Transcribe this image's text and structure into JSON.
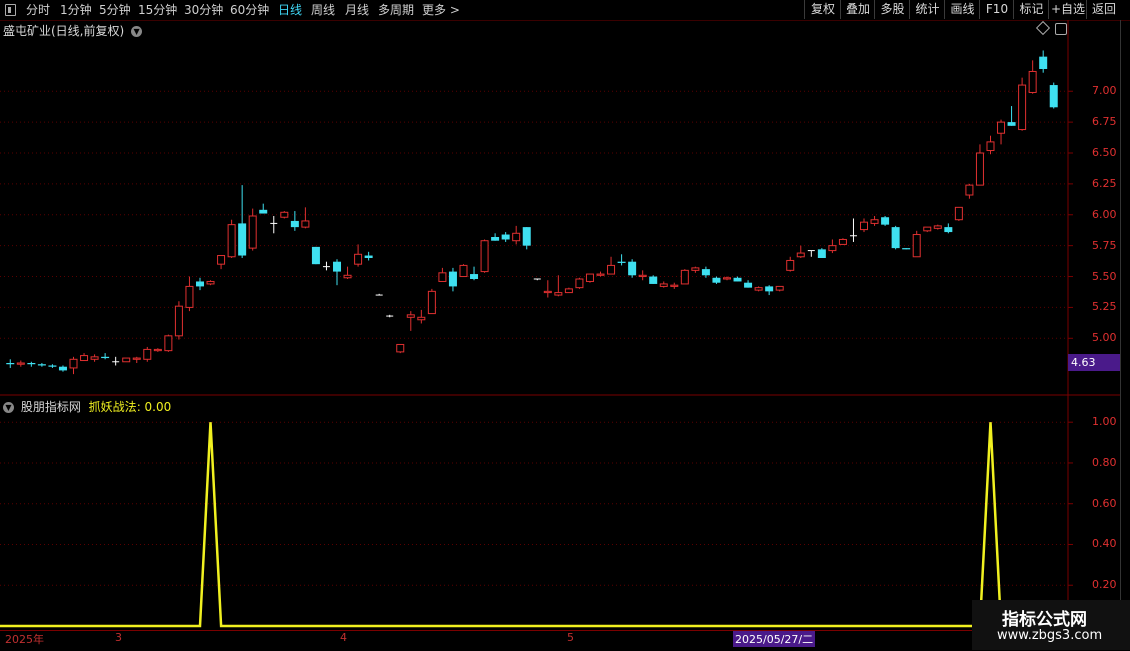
{
  "toolbar": {
    "periods": [
      "分时",
      "1分钟",
      "5分钟",
      "15分钟",
      "30分钟",
      "60分钟",
      "日线",
      "周线",
      "月线",
      "多周期",
      "更多"
    ],
    "active_period": "日线",
    "right_buttons": [
      "复权",
      "叠加",
      "多股",
      "统计",
      "画线",
      "F10",
      "标记",
      "+自选",
      "返回"
    ]
  },
  "main_title": "盛屯矿业(日线,前复权)",
  "current_price_label": "4.63",
  "indicator": {
    "source": "股朋指标网",
    "name": "抓妖战法",
    "value": "0.00",
    "label_sep": ": "
  },
  "date_axis": {
    "labels": [
      "2025年",
      "3",
      "4",
      "5",
      "2025/05/27/二"
    ]
  },
  "watermark": {
    "title": "指标公式网",
    "url": "www.zbgs3.com"
  },
  "colors": {
    "up": "#e03030",
    "down": "#3fe0f0",
    "indicator_line": "#f0f020",
    "grid": "#5a0000",
    "axis_text": "#e03030",
    "active_tab": "#3fd6f5"
  },
  "chart_data": [
    {
      "type": "candlestick",
      "title": "盛屯矿业(日线,前复权)",
      "y_ticks": [
        5.0,
        5.25,
        5.5,
        5.75,
        6.0,
        6.25,
        6.5,
        6.75,
        7.0
      ],
      "ylim": [
        4.63,
        7.35
      ],
      "grid": true,
      "candles": [
        [
          4.8,
          4.83,
          4.76,
          4.79
        ],
        [
          4.79,
          4.82,
          4.77,
          4.8
        ],
        [
          4.8,
          4.81,
          4.77,
          4.79
        ],
        [
          4.79,
          4.8,
          4.77,
          4.78
        ],
        [
          4.78,
          4.79,
          4.76,
          4.77
        ],
        [
          4.77,
          4.78,
          4.73,
          4.74
        ],
        [
          4.76,
          4.85,
          4.71,
          4.83
        ],
        [
          4.82,
          4.88,
          4.82,
          4.86
        ],
        [
          4.83,
          4.87,
          4.81,
          4.85
        ],
        [
          4.85,
          4.88,
          4.83,
          4.84
        ],
        [
          4.81,
          4.85,
          4.78,
          4.81
        ],
        [
          4.81,
          4.84,
          4.81,
          4.84
        ],
        [
          4.83,
          4.85,
          4.8,
          4.84
        ],
        [
          4.83,
          4.93,
          4.81,
          4.91
        ],
        [
          4.9,
          4.92,
          4.89,
          4.91
        ],
        [
          4.9,
          5.03,
          4.89,
          5.02
        ],
        [
          5.02,
          5.3,
          4.99,
          5.26
        ],
        [
          5.25,
          5.5,
          5.22,
          5.42
        ],
        [
          5.46,
          5.49,
          5.39,
          5.42
        ],
        [
          5.44,
          5.47,
          5.43,
          5.46
        ],
        [
          5.6,
          5.67,
          5.56,
          5.67
        ],
        [
          5.66,
          5.96,
          5.65,
          5.92
        ],
        [
          5.93,
          6.24,
          5.65,
          5.67
        ],
        [
          5.73,
          6.05,
          5.71,
          5.99
        ],
        [
          6.04,
          6.09,
          6.01,
          6.01
        ],
        [
          5.93,
          5.99,
          5.85,
          5.93
        ],
        [
          5.98,
          6.03,
          5.97,
          6.02
        ],
        [
          5.95,
          6.03,
          5.87,
          5.9
        ],
        [
          5.9,
          6.06,
          5.89,
          5.95
        ],
        [
          5.74,
          5.74,
          5.6,
          5.6
        ],
        [
          5.58,
          5.62,
          5.55,
          5.58
        ],
        [
          5.62,
          5.64,
          5.43,
          5.54
        ],
        [
          5.49,
          5.58,
          5.48,
          5.51
        ],
        [
          5.6,
          5.76,
          5.58,
          5.68
        ],
        [
          5.67,
          5.7,
          5.63,
          5.65
        ],
        [
          5.35,
          5.36,
          5.35,
          5.35
        ],
        [
          5.18,
          5.19,
          5.17,
          5.18
        ],
        [
          4.89,
          4.95,
          4.88,
          4.95
        ],
        [
          5.17,
          5.22,
          5.06,
          5.19
        ],
        [
          5.15,
          5.23,
          5.12,
          5.17
        ],
        [
          5.2,
          5.4,
          5.2,
          5.38
        ],
        [
          5.46,
          5.57,
          5.46,
          5.53
        ],
        [
          5.54,
          5.57,
          5.38,
          5.42
        ],
        [
          5.5,
          5.6,
          5.5,
          5.59
        ],
        [
          5.52,
          5.58,
          5.47,
          5.48
        ],
        [
          5.54,
          5.8,
          5.53,
          5.79
        ],
        [
          5.82,
          5.85,
          5.79,
          5.79
        ],
        [
          5.84,
          5.86,
          5.78,
          5.8
        ],
        [
          5.79,
          5.91,
          5.76,
          5.85
        ],
        [
          5.9,
          5.9,
          5.72,
          5.75
        ],
        [
          5.48,
          5.48,
          5.47,
          5.48
        ],
        [
          5.37,
          5.47,
          5.33,
          5.38
        ],
        [
          5.35,
          5.51,
          5.34,
          5.37
        ],
        [
          5.37,
          5.41,
          5.37,
          5.4
        ],
        [
          5.41,
          5.49,
          5.4,
          5.48
        ],
        [
          5.46,
          5.52,
          5.45,
          5.52
        ],
        [
          5.51,
          5.54,
          5.5,
          5.52
        ],
        [
          5.52,
          5.66,
          5.52,
          5.59
        ],
        [
          5.62,
          5.68,
          5.59,
          5.61
        ],
        [
          5.62,
          5.64,
          5.49,
          5.51
        ],
        [
          5.5,
          5.55,
          5.47,
          5.51
        ],
        [
          5.5,
          5.51,
          5.44,
          5.44
        ],
        [
          5.42,
          5.46,
          5.41,
          5.44
        ],
        [
          5.42,
          5.45,
          5.4,
          5.43
        ],
        [
          5.44,
          5.56,
          5.44,
          5.55
        ],
        [
          5.55,
          5.58,
          5.53,
          5.57
        ],
        [
          5.56,
          5.58,
          5.49,
          5.51
        ],
        [
          5.49,
          5.5,
          5.44,
          5.45
        ],
        [
          5.48,
          5.5,
          5.47,
          5.49
        ],
        [
          5.49,
          5.5,
          5.46,
          5.46
        ],
        [
          5.45,
          5.47,
          5.41,
          5.41
        ],
        [
          5.39,
          5.42,
          5.38,
          5.41
        ],
        [
          5.42,
          5.43,
          5.35,
          5.38
        ],
        [
          5.39,
          5.42,
          5.38,
          5.42
        ],
        [
          5.55,
          5.66,
          5.54,
          5.63
        ],
        [
          5.66,
          5.75,
          5.65,
          5.69
        ],
        [
          5.71,
          5.71,
          5.66,
          5.71
        ],
        [
          5.72,
          5.73,
          5.65,
          5.65
        ],
        [
          5.71,
          5.8,
          5.69,
          5.75
        ],
        [
          5.76,
          5.81,
          5.76,
          5.8
        ],
        [
          5.83,
          5.97,
          5.78,
          5.83
        ],
        [
          5.88,
          5.97,
          5.86,
          5.94
        ],
        [
          5.93,
          5.99,
          5.91,
          5.96
        ],
        [
          5.98,
          5.99,
          5.91,
          5.92
        ],
        [
          5.9,
          5.91,
          5.72,
          5.73
        ],
        [
          5.73,
          5.73,
          5.72,
          5.72
        ],
        [
          5.66,
          5.87,
          5.66,
          5.84
        ],
        [
          5.87,
          5.9,
          5.86,
          5.9
        ],
        [
          5.89,
          5.92,
          5.88,
          5.91
        ],
        [
          5.9,
          5.93,
          5.85,
          5.86
        ],
        [
          5.96,
          6.06,
          5.95,
          6.06
        ],
        [
          6.16,
          6.25,
          6.13,
          6.24
        ],
        [
          6.24,
          6.57,
          6.24,
          6.5
        ],
        [
          6.52,
          6.64,
          6.49,
          6.59
        ],
        [
          6.66,
          6.77,
          6.57,
          6.75
        ],
        [
          6.75,
          6.88,
          6.72,
          6.72
        ],
        [
          6.69,
          7.11,
          6.68,
          7.05
        ],
        [
          6.99,
          7.25,
          6.98,
          7.16
        ],
        [
          7.28,
          7.33,
          7.15,
          7.18
        ],
        [
          7.05,
          7.07,
          6.86,
          6.87
        ]
      ]
    },
    {
      "type": "line",
      "name": "抓妖战法",
      "y_ticks": [
        0.2,
        0.4,
        0.6,
        0.8,
        1.0
      ],
      "ylim": [
        0,
        1.05
      ],
      "values": [
        0,
        0,
        0,
        0,
        0,
        0,
        0,
        0,
        0,
        0,
        0,
        0,
        0,
        0,
        0,
        0,
        0,
        0,
        0,
        1,
        0,
        0,
        0,
        0,
        0,
        0,
        0,
        0,
        0,
        0,
        0,
        0,
        0,
        0,
        0,
        0,
        0,
        0,
        0,
        0,
        0,
        0,
        0,
        0,
        0,
        0,
        0,
        0,
        0,
        0,
        0,
        0,
        0,
        0,
        0,
        0,
        0,
        0,
        0,
        0,
        0,
        0,
        0,
        0,
        0,
        0,
        0,
        0,
        0,
        0,
        0,
        0,
        0,
        0,
        0,
        0,
        0,
        0,
        0,
        0,
        0,
        0,
        0,
        0,
        0,
        0,
        0,
        0,
        0,
        0,
        0,
        0,
        0,
        1,
        0,
        0,
        0,
        0,
        0,
        0
      ]
    }
  ]
}
